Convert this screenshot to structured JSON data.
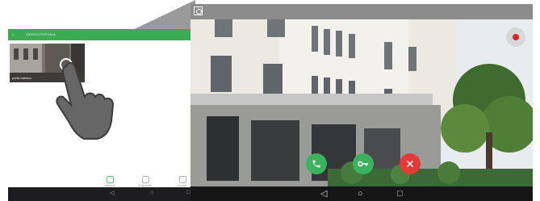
{
  "phone": {
    "back_icon": "arrow-left-icon",
    "title": "VIDEOCITOFONIA",
    "thumbnail_label": "porta esterna",
    "tabs": [
      {
        "label": "Videocit.",
        "icon": "video-icon"
      },
      {
        "label": "Foto scatt.",
        "icon": "photo-icon"
      },
      {
        "label": "Impost.",
        "icon": "settings-icon"
      }
    ]
  },
  "screen": {
    "corner_icon": "rotate-icon",
    "record_icon": "record-icon",
    "actions": [
      {
        "name": "call-button",
        "icon": "phone-icon",
        "color": "#3bb35c"
      },
      {
        "name": "open-door-button",
        "icon": "key-icon",
        "color": "#3bb35c"
      },
      {
        "name": "hangup-button",
        "icon": "close-icon",
        "color": "#e53935"
      }
    ],
    "nav": [
      "back-icon",
      "home-icon",
      "recents-icon"
    ]
  },
  "colors": {
    "accent": "#3bab54",
    "danger": "#e53935",
    "record": "#e02020"
  }
}
